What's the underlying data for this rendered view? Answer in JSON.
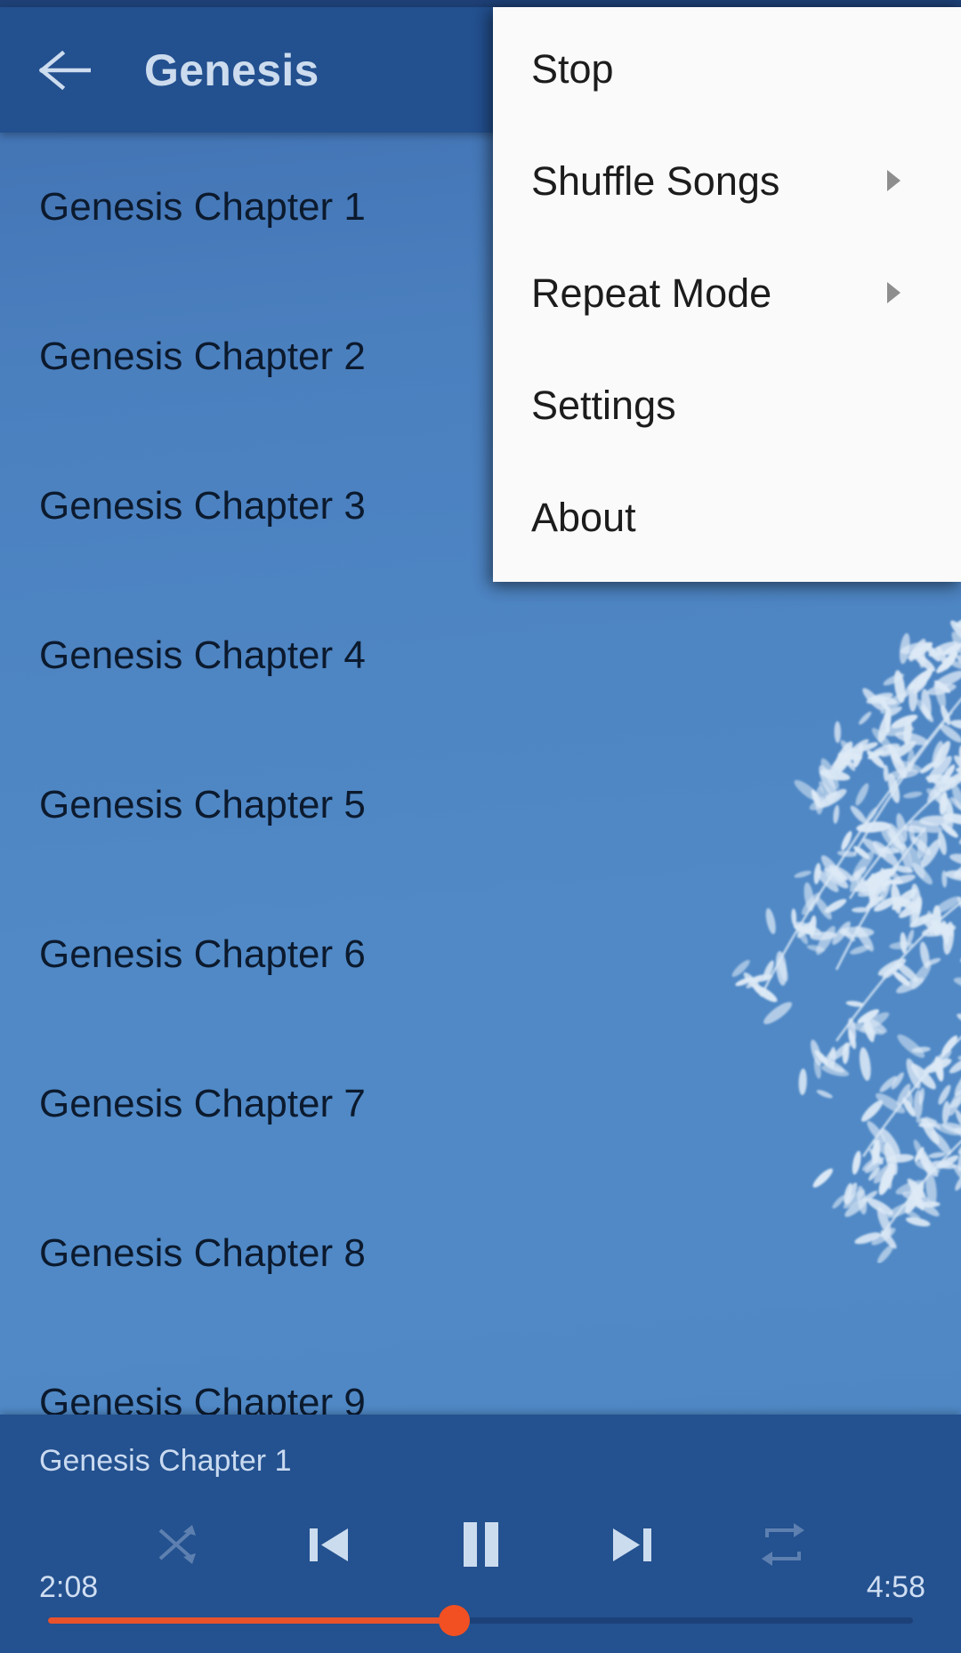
{
  "app": {
    "accent_color": "#f25022",
    "appbar_color": "#23508f",
    "background_color": "#5089c6",
    "player_color": "#24518f"
  },
  "appbar": {
    "back_icon": "arrow-left-icon",
    "title": "Genesis"
  },
  "list": {
    "items": [
      {
        "label": "Genesis Chapter 1"
      },
      {
        "label": "Genesis Chapter 2"
      },
      {
        "label": "Genesis Chapter 3"
      },
      {
        "label": "Genesis Chapter 4"
      },
      {
        "label": "Genesis Chapter 5"
      },
      {
        "label": "Genesis Chapter 6"
      },
      {
        "label": "Genesis Chapter 7"
      },
      {
        "label": "Genesis Chapter 8"
      },
      {
        "label": "Genesis Chapter 9"
      }
    ]
  },
  "menu": {
    "items": [
      {
        "label": "Stop",
        "has_submenu": false
      },
      {
        "label": "Shuffle Songs",
        "has_submenu": true
      },
      {
        "label": "Repeat Mode",
        "has_submenu": true
      },
      {
        "label": "Settings",
        "has_submenu": false
      },
      {
        "label": "About",
        "has_submenu": false
      }
    ]
  },
  "player": {
    "track_title": "Genesis Chapter 1",
    "time_current": "2:08",
    "time_total": "4:58",
    "progress_percent": 47,
    "controls": [
      {
        "name": "shuffle-icon",
        "state": "off"
      },
      {
        "name": "previous-icon",
        "state": "on"
      },
      {
        "name": "pause-icon",
        "state": "on"
      },
      {
        "name": "next-icon",
        "state": "on"
      },
      {
        "name": "repeat-icon",
        "state": "off"
      }
    ]
  }
}
